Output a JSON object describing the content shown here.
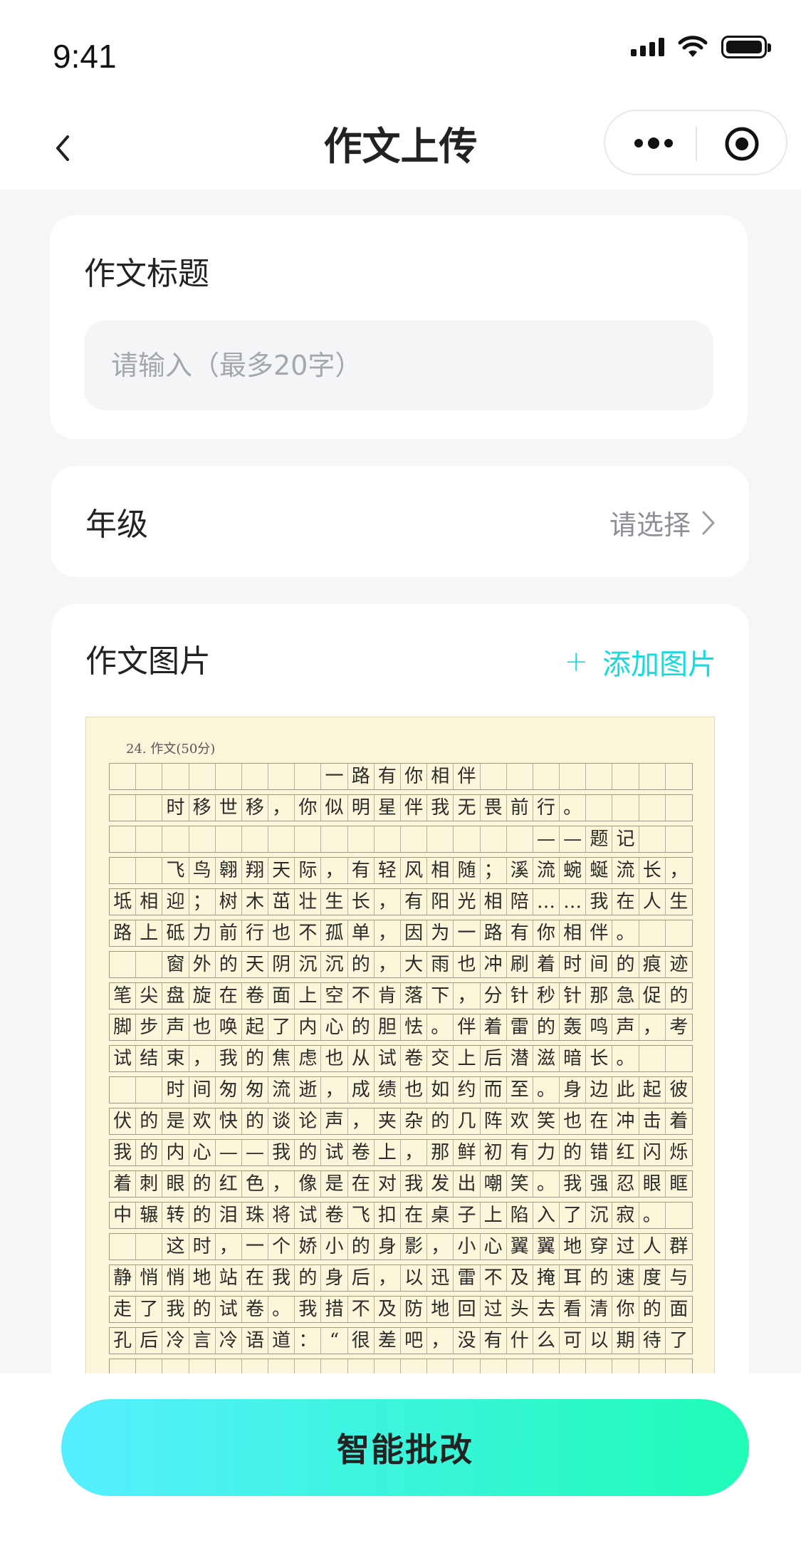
{
  "status_bar": {
    "time": "9:41"
  },
  "nav": {
    "title": "作文上传",
    "back_icon": "chevron-left-icon",
    "more_icon": "more-dots-icon",
    "close_icon": "target-icon"
  },
  "title_section": {
    "label": "作文标题",
    "input_value": "",
    "placeholder": "请输入（最多20字）"
  },
  "grade_section": {
    "label": "年级",
    "select_text": "请选择"
  },
  "image_section": {
    "label": "作文图片",
    "add_plus": "+",
    "add_label": "添加图片",
    "essay": {
      "header": "24. 作文(50分)",
      "lines": [
        "一路有你相伴",
        "时移世移，你似明星伴我无畏前行。",
        "——题记",
        "飞鸟翱翔天际，有轻风相随；溪流蜿蜒流长，有岸",
        "坻相迎；树木茁壮生长，有阳光相陪……我在人生道",
        "路上砥力前行也不孤单，因为一路有你相伴。",
        "窗外的天阴沉沉的，大雨也冲刷着时间的痕迹。",
        "笔尖盘旋在卷面上空不肯落下，分针秒针那急促的",
        "脚步声也唤起了内心的胆怯。伴着雷的轰鸣声，考",
        "试结束，我的焦虑也从试卷交上后潜滋暗长。",
        "时间匆匆流逝，成绩也如约而至。身边此起彼",
        "伏的是欢快的谈论声，夹杂的几阵欢笑也在冲击着",
        "我的内心——我的试卷上，那鲜初有力的错红闪烁",
        "着刺眼的红色，像是在对我发出嘲笑。我强忍眼眶",
        "中辗转的泪珠将试卷飞扣在桌子上陷入了沉寂。",
        "这时，一个娇小的身影，小心翼翼地穿过人群",
        "静悄悄地站在我的身后，以迅雷不及掩耳的速度与",
        "走了我的试卷。我措不及防地回过头去看清你的面",
        "孔后冷言冷语道：“很差吧，没有什么可以期待了。”",
        ""
      ]
    }
  },
  "submit": {
    "label": "智能批改"
  },
  "colors": {
    "accent": "#13dbe0",
    "gradient_start": "#56eeff",
    "gradient_end": "#1ffcb7"
  }
}
